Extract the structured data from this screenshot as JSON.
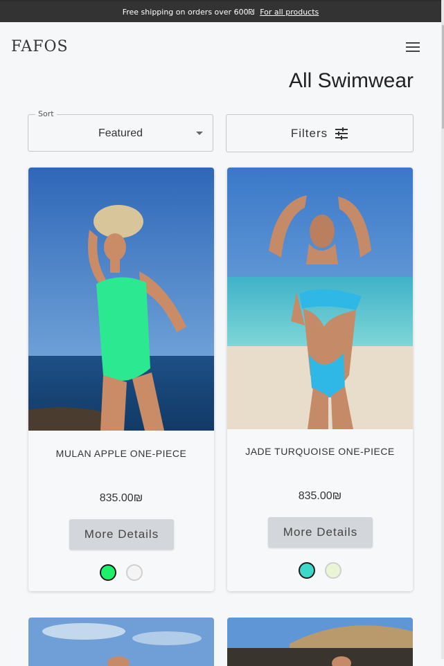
{
  "announcement": {
    "text": "Free shipping on orders over 600₪",
    "link": "For all products"
  },
  "header": {
    "logo": "FAFOS",
    "menu_icon": "hamburger-menu-icon"
  },
  "page": {
    "title": "All Swimwear"
  },
  "sort": {
    "label": "Sort",
    "selected": "Featured"
  },
  "filters": {
    "label": "Filters",
    "icon": "sliders-icon"
  },
  "products": [
    {
      "name": "MULAN APPLE ONE-PIECE",
      "price": "835.00₪",
      "cta": "More Details",
      "swatches": [
        "#1ef06a",
        "#f4f4f4"
      ]
    },
    {
      "name": "JADE TURQUOISE ONE-PIECE",
      "price": "835.00₪",
      "cta": "More Details",
      "swatches": [
        "#3ed8c8",
        "#e9f5d6"
      ]
    }
  ],
  "colors": {
    "topbar": "#333333",
    "button": "#d3d6db",
    "background": "#f6f7f9"
  }
}
